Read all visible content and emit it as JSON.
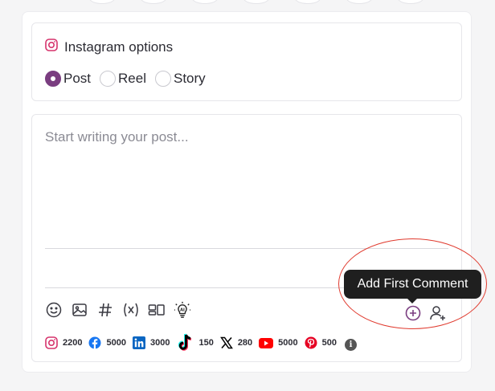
{
  "instagram_options": {
    "title": "Instagram options",
    "post_types": [
      {
        "label": "Post",
        "checked": true
      },
      {
        "label": "Reel",
        "checked": false
      },
      {
        "label": "Story",
        "checked": false
      }
    ]
  },
  "editor": {
    "placeholder": "Start writing your post...",
    "value": ""
  },
  "toolbar": {
    "tools": [
      "emoji-icon",
      "image-icon",
      "hashtag-icon",
      "variable-icon",
      "template-icon",
      "ai-assist-icon"
    ],
    "right_tools": [
      "add-first-comment-icon",
      "add-user-icon"
    ]
  },
  "tooltip": {
    "text": "Add First Comment"
  },
  "char_limits": [
    {
      "network": "instagram",
      "limit": "2200",
      "color": "#d6336c"
    },
    {
      "network": "facebook",
      "limit": "5000",
      "color": "#1877f2"
    },
    {
      "network": "linkedin",
      "limit": "3000",
      "color": "#0a66c2"
    },
    {
      "network": "tiktok",
      "limit": "150",
      "color": "#000000"
    },
    {
      "network": "x",
      "limit": "280",
      "color": "#000000"
    },
    {
      "network": "youtube",
      "limit": "5000",
      "color": "#ff0000"
    },
    {
      "network": "pinterest",
      "limit": "500",
      "color": "#e60023"
    }
  ],
  "colors": {
    "accent": "#7a3d80",
    "highlight": "#e03a2e"
  }
}
